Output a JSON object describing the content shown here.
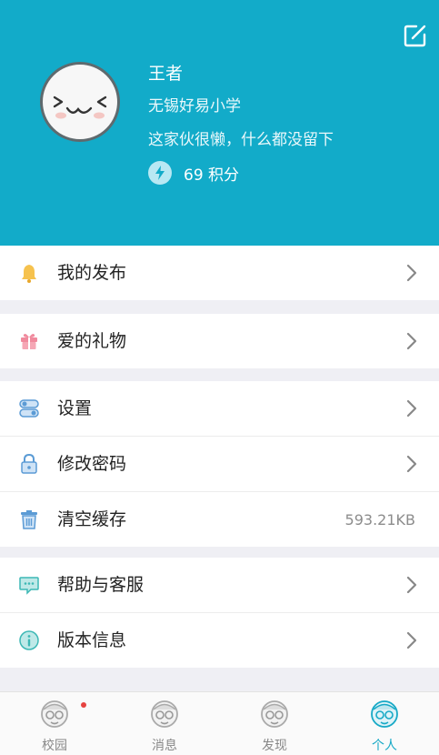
{
  "profile": {
    "name": "王者",
    "school": "无锡好易小学",
    "bio": "这家伙很懒，什么都没留下",
    "points": "69 积分"
  },
  "header": {
    "edit_icon": "edit-icon",
    "bg_color": "#12abc9"
  },
  "menu": {
    "my_posts": {
      "label": "我的发布",
      "icon": "bell-icon"
    },
    "gifts": {
      "label": "爱的礼物",
      "icon": "gift-icon"
    },
    "settings": {
      "label": "设置",
      "icon": "toggle-icon"
    },
    "change_password": {
      "label": "修改密码",
      "icon": "lock-icon"
    },
    "clear_cache": {
      "label": "清空缓存",
      "icon": "trash-icon",
      "value": "593.21KB"
    },
    "help": {
      "label": "帮助与客服",
      "icon": "chat-icon"
    },
    "version": {
      "label": "版本信息",
      "icon": "info-icon"
    }
  },
  "tabs": [
    {
      "label": "校园",
      "icon": "grandpa-icon",
      "has_badge": true
    },
    {
      "label": "消息",
      "icon": "grandpa-icon"
    },
    {
      "label": "发现",
      "icon": "grandpa-icon"
    },
    {
      "label": "个人",
      "icon": "grandpa-icon",
      "active": true
    }
  ],
  "colors": {
    "accent": "#17a9c6",
    "badge": "#e64340"
  }
}
